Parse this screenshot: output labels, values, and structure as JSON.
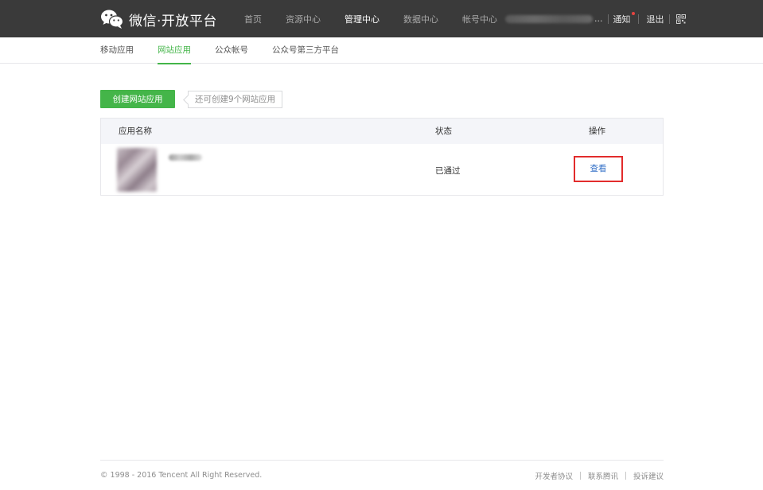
{
  "header": {
    "logo_icon": "wechat-icon",
    "title": "微信·开放平台",
    "nav": [
      {
        "label": "首页"
      },
      {
        "label": "资源中心"
      },
      {
        "label": "管理中心"
      },
      {
        "label": "数据中心"
      },
      {
        "label": "帐号中心"
      }
    ],
    "active_nav": "管理中心",
    "ellipsis": "...",
    "notify_label": "通知",
    "logout_label": "退出",
    "qr_icon": "qrcode-icon"
  },
  "subnav": {
    "items": [
      {
        "label": "移动应用"
      },
      {
        "label": "网站应用"
      },
      {
        "label": "公众帐号"
      },
      {
        "label": "公众号第三方平台"
      }
    ],
    "active": "网站应用"
  },
  "actions": {
    "create_label": "创建网站应用",
    "hint": "还可创建9个网站应用"
  },
  "table": {
    "headers": {
      "name": "应用名称",
      "status": "状态",
      "action": "操作"
    },
    "rows": [
      {
        "status": "已通过",
        "action_label": "查看"
      }
    ]
  },
  "footer": {
    "copyright": "© 1998 - 2016 Tencent All Right Reserved.",
    "links": [
      {
        "label": "开发者协议"
      },
      {
        "label": "联系腾讯"
      },
      {
        "label": "投诉建议"
      }
    ]
  },
  "colors": {
    "header_bg": "#3a3a3a",
    "accent_green": "#44b549",
    "link_blue": "#3370c7",
    "highlight_red": "#e22c2c",
    "notify_dot": "#e64340"
  }
}
